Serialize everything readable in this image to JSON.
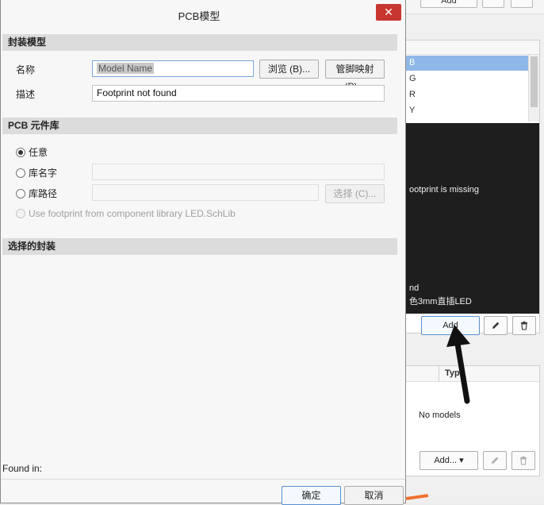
{
  "dialog": {
    "title": "PCB模型",
    "close_glyph": "✕",
    "sections": {
      "footprint_model": "封装模型",
      "pcb_library": "PCB 元件库",
      "selected_footprint": "选择的封装"
    },
    "name_label": "名称",
    "name_value": "Model Name",
    "browse_button": "浏览 (B)...",
    "pin_map_button": "管脚映射 (P)...",
    "desc_label": "描述",
    "desc_value": "Footprint not found",
    "library_options": {
      "any": "任意",
      "lib_name": "库名字",
      "lib_path": "库路径",
      "use_component_lib": "Use footprint from component library LED.SchLib"
    },
    "choose_button": "选择 (C)...",
    "found_in": "Found in:",
    "ok_button": "确定",
    "cancel_button": "取消"
  },
  "background": {
    "top_add_button": "Add",
    "list_rows": [
      "B",
      "G",
      "R",
      "Y"
    ],
    "dark_panel_lines": [
      "ootprint is missing",
      "nd",
      "色3mm直插LED"
    ],
    "add_button": "Add",
    "models_type_header": "Typ",
    "no_models": "No models",
    "add_dropdown_button": "Add..."
  },
  "colors": {
    "close_button": "#c7372f",
    "list_selection": "#8fb8e8",
    "dark_panel": "#1e1e1e",
    "focus_border": "#5a8fd0"
  }
}
